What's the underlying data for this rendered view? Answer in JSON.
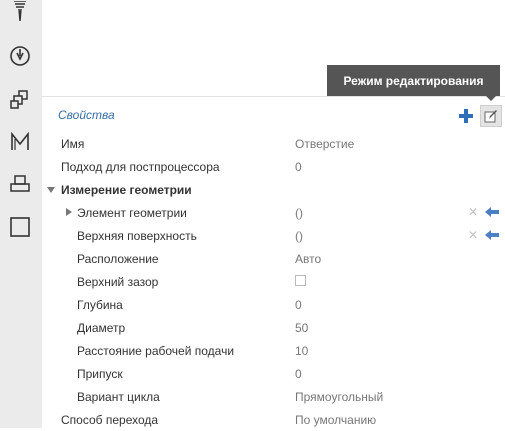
{
  "toolbar": {
    "items": [
      {
        "icon": "drill-icon"
      },
      {
        "icon": "compass-icon"
      },
      {
        "icon": "blocks-icon"
      },
      {
        "icon": "m-icon"
      },
      {
        "icon": "printer-icon"
      },
      {
        "icon": "square-icon"
      }
    ]
  },
  "tooltip": "Режим редактирования",
  "properties": {
    "title": "Свойства",
    "rows": [
      {
        "label": "Имя",
        "value": "Отверстие"
      },
      {
        "label": "Подход для постпроцессора",
        "value": "0"
      },
      {
        "label": "Измерение геометрии",
        "value": ""
      },
      {
        "label": "Элемент геометрии",
        "value": "()"
      },
      {
        "label": "Верхняя поверхность",
        "value": "()"
      },
      {
        "label": "Расположение",
        "value": "Авто"
      },
      {
        "label": "Верхний зазор",
        "value": "false"
      },
      {
        "label": "Глубина",
        "value": "0"
      },
      {
        "label": "Диаметр",
        "value": "50"
      },
      {
        "label": "Расстояние рабочей подачи",
        "value": "10"
      },
      {
        "label": "Припуск",
        "value": "0"
      },
      {
        "label": "Вариант цикла",
        "value": "Прямоугольный"
      },
      {
        "label": "Способ перехода",
        "value": "По умолчанию"
      }
    ]
  },
  "colors": {
    "accent": "#3b6ea5",
    "plus": "#2f6fb8",
    "arrow": "#4d7fc4"
  }
}
